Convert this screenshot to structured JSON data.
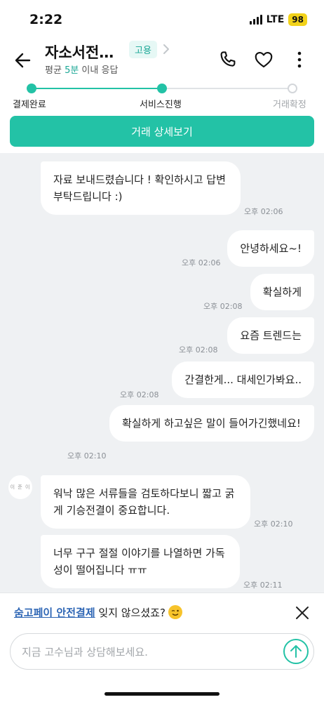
{
  "status_bar": {
    "time": "2:22",
    "network": "LTE",
    "battery": "98"
  },
  "header": {
    "name": "자소서전…",
    "badge": "고용",
    "response_prefix": "평균 ",
    "response_highlight": "5분",
    "response_suffix": " 이내 응답",
    "icons": [
      "back-arrow-icon",
      "chevron-right-icon",
      "phone-icon",
      "heart-icon",
      "more-vertical-icon"
    ]
  },
  "progress": {
    "steps": [
      {
        "label": "결제완료",
        "state": "done"
      },
      {
        "label": "서비스진행",
        "state": "current"
      },
      {
        "label": "거래확정",
        "state": "pending"
      }
    ]
  },
  "detail_button": "거래 상세보기",
  "messages": [
    {
      "side": "in",
      "text": "자료 보내드렸습니다 ! 확인하시고 답변 부탁드립니다 :)",
      "time": "오후 02:06"
    },
    {
      "side": "out",
      "text": "안녕하세요~!",
      "time": "오후 02:06"
    },
    {
      "side": "out",
      "text": "확실하게",
      "time": "오후 02:08"
    },
    {
      "side": "out",
      "text": "요즘 트렌드는",
      "time": "오후 02:08"
    },
    {
      "side": "out",
      "text": "간결한게... 대세인가봐요..",
      "time": "오후 02:08"
    },
    {
      "side": "out",
      "text": "확실하게 하고싶은 말이 들어가긴했네요!",
      "time": "오후 02:10"
    },
    {
      "side": "in",
      "text": "워낙 많은 서류들을 검토하다보니 짧고 굵게 기승전결이 중요합니다.",
      "time": "오후 02:10"
    },
    {
      "side": "in",
      "text": "너무 구구 절절 이야기를 나열하면 가독성이 떨어집니다 ㅠㅠ",
      "time": "오후 02:11"
    }
  ],
  "avatar_text": "이 준 이",
  "notice": {
    "link": "숨고페이 안전결제",
    "rest": " 잊지 않으셨죠?"
  },
  "input": {
    "placeholder": "지금 고수님과 상담해보세요."
  },
  "colors": {
    "accent": "#23c2a6",
    "accent_text": "#1ba796",
    "link": "#2e66b5",
    "chat_bg": "#eff1f3"
  }
}
